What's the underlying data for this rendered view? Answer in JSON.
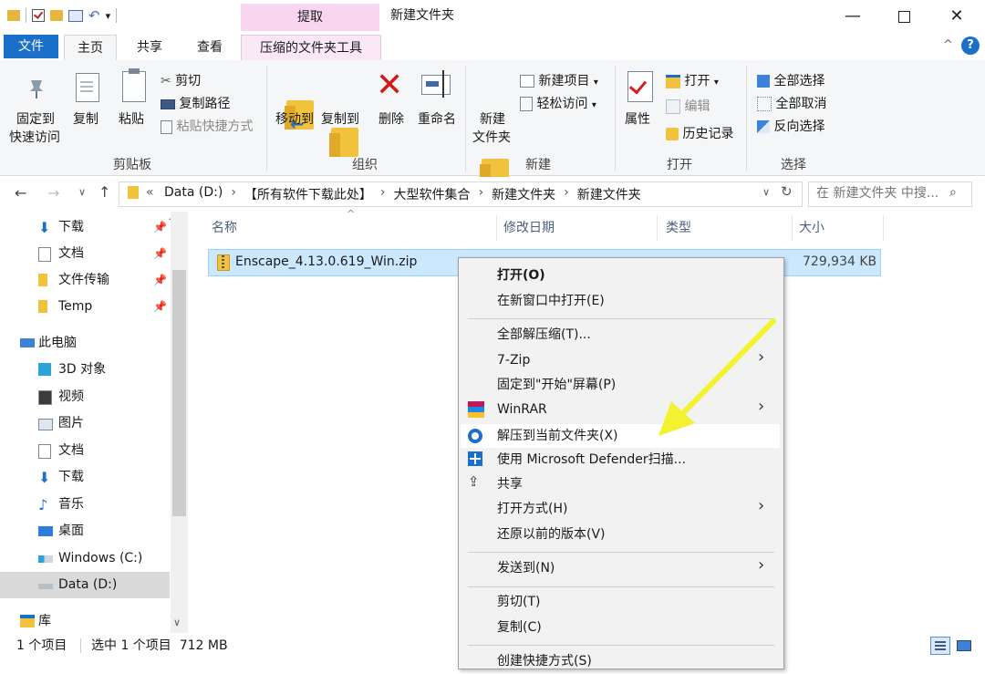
{
  "window": {
    "title": "新建文件夹",
    "context_tab_header": "提取"
  },
  "tabs": {
    "file": "文件",
    "home": "主页",
    "share": "共享",
    "view": "查看",
    "compress_tools": "压缩的文件夹工具"
  },
  "ribbon": {
    "clipboard": {
      "label": "剪贴板",
      "pin_quick": "固定到",
      "pin_quick2": "快速访问",
      "copy": "复制",
      "paste": "粘贴",
      "cut": "剪切",
      "copy_path": "复制路径",
      "paste_shortcut": "粘贴快捷方式"
    },
    "organize": {
      "label": "组织",
      "move_to": "移动到",
      "copy_to": "复制到",
      "delete": "删除",
      "rename": "重命名"
    },
    "new": {
      "label": "新建",
      "new_folder": "新建",
      "new_folder2": "文件夹",
      "new_item": "新建项目",
      "easy_access": "轻松访问"
    },
    "open": {
      "label": "打开",
      "properties": "属性",
      "open": "打开",
      "edit": "编辑",
      "history": "历史记录"
    },
    "select": {
      "label": "选择",
      "select_all": "全部选择",
      "select_none": "全部取消",
      "invert": "反向选择"
    }
  },
  "address": {
    "crumbs": [
      "Data (D:)",
      "【所有软件下载此处】",
      "大型软件集合",
      "新建文件夹",
      "新建文件夹"
    ],
    "search_placeholder": "在 新建文件夹 中搜..."
  },
  "nav": {
    "items": [
      {
        "label": "下载"
      },
      {
        "label": "文档"
      },
      {
        "label": "文件传输"
      },
      {
        "label": "Temp"
      },
      {
        "label": "此电脑"
      },
      {
        "label": "3D 对象"
      },
      {
        "label": "视频"
      },
      {
        "label": "图片"
      },
      {
        "label": "文档"
      },
      {
        "label": "下载"
      },
      {
        "label": "音乐"
      },
      {
        "label": "桌面"
      },
      {
        "label": "Windows (C:)"
      },
      {
        "label": "Data (D:)"
      },
      {
        "label": "库"
      }
    ]
  },
  "columns": {
    "name": "名称",
    "modified": "修改日期",
    "type": "类型",
    "size": "大小"
  },
  "files": [
    {
      "name": "Enscape_4.13.0.619_Win.zip",
      "size": "729,934 KB"
    }
  ],
  "status": {
    "count": "1 个项目",
    "selected": "选中 1 个项目  712 MB"
  },
  "context_menu": {
    "open": "打开(O)",
    "open_new_window": "在新窗口中打开(E)",
    "extract_all": "全部解压缩(T)...",
    "seven_zip": "7-Zip",
    "pin_start": "固定到\"开始\"屏幕(P)",
    "winrar": "WinRAR",
    "extract_here": "解压到当前文件夹(X)",
    "defender": "使用 Microsoft Defender扫描...",
    "share": "共享",
    "open_with": "打开方式(H)",
    "restore": "还原以前的版本(V)",
    "send_to": "发送到(N)",
    "cut": "剪切(T)",
    "copy": "复制(C)",
    "create_shortcut": "创建快捷方式(S)"
  },
  "colors": {
    "accent": "#1a6fc9",
    "selection": "#cce8ff",
    "arrow": "#f2f230"
  }
}
